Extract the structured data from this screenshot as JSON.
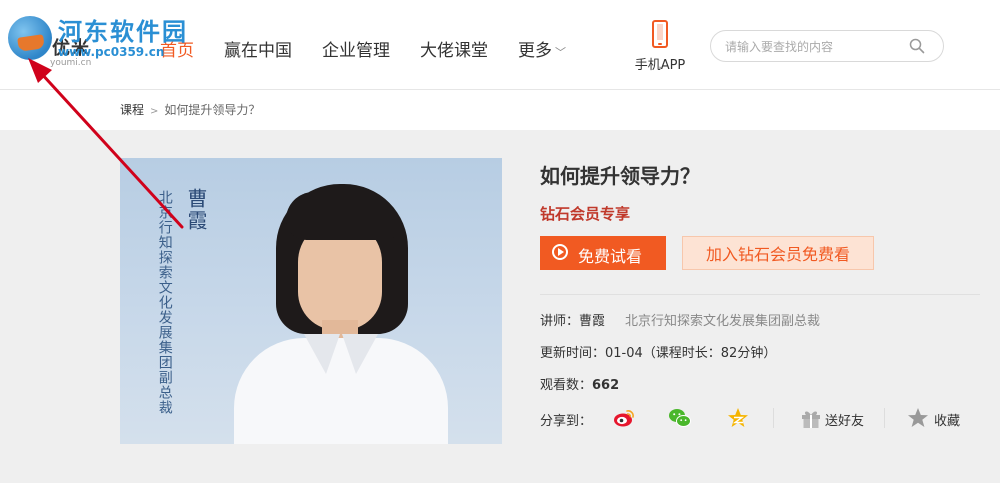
{
  "logo": {
    "text": "优米",
    "sub": "youmi.cn"
  },
  "watermark": {
    "title": "河东软件园",
    "url": "www.pc0359.cn"
  },
  "nav": [
    {
      "label": "首页",
      "active": true
    },
    {
      "label": "赢在中国"
    },
    {
      "label": "企业管理"
    },
    {
      "label": "大佬课堂"
    },
    {
      "label": "更多"
    }
  ],
  "app": {
    "label": "手机APP"
  },
  "search": {
    "placeholder": "请输入要查找的内容",
    "value": ""
  },
  "breadcrumb": {
    "root": "课程",
    "separator": ">",
    "current": "如何提升领导力？"
  },
  "cover": {
    "vertical_text": "北京行知探索文化发展集团副总裁",
    "name": "曹霞"
  },
  "course": {
    "title": "如何提升领导力？",
    "member_tag": "钻石会员专享",
    "trial_button": "免费试看",
    "join_button": "加入钻石会员免费看",
    "teacher_label": "讲师：",
    "teacher_name": "曹霞",
    "teacher_title": "北京行知探索文化发展集团副总裁",
    "update_text": "更新时间：01-04（课程时长：82分钟）",
    "views_label": "观看数：",
    "views_count": "662",
    "share_label": "分享到：",
    "gift_label": "送好友",
    "fav_label": "收藏"
  },
  "colors": {
    "accent": "#f15a22",
    "member_red": "#c0392b",
    "join_bg": "#fde3d4",
    "watermark": "#2a8fd4",
    "annotation": "#d0021b"
  }
}
